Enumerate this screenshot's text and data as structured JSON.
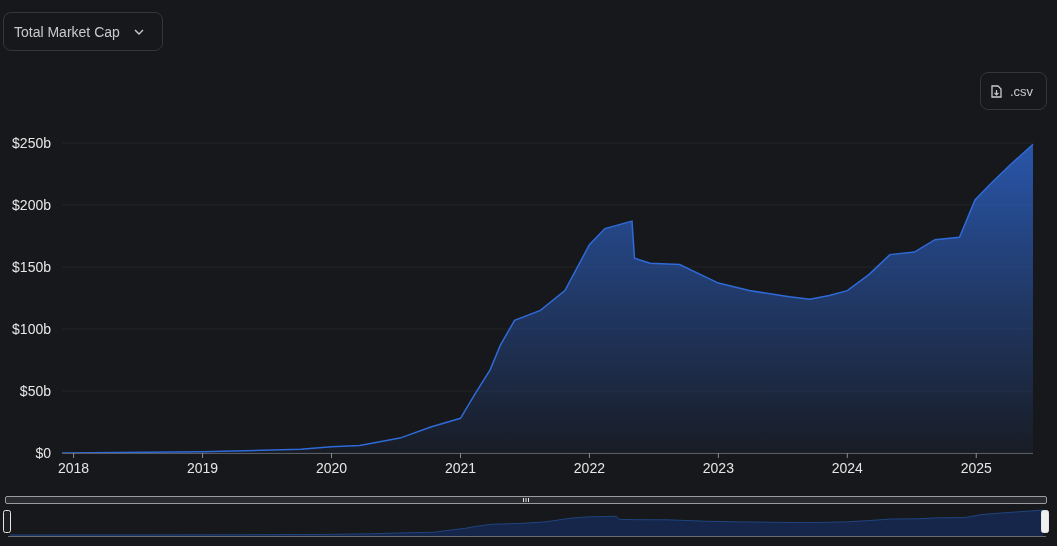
{
  "metric_dropdown": {
    "label": "Total Market Cap"
  },
  "csv_button": {
    "label": ".csv"
  },
  "chart_data": {
    "type": "area",
    "x": [
      2017.91,
      2019.0,
      2019.76,
      2020.0,
      2020.22,
      2020.53,
      2020.77,
      2021.0,
      2021.11,
      2021.23,
      2021.31,
      2021.42,
      2021.62,
      2021.81,
      2022.0,
      2022.12,
      2022.33,
      2022.35,
      2022.47,
      2022.7,
      2023.0,
      2023.24,
      2023.55,
      2023.71,
      2023.86,
      2024.0,
      2024.17,
      2024.33,
      2024.52,
      2024.68,
      2024.87,
      2024.99,
      2025.1,
      2025.26,
      2025.44
    ],
    "series": [
      {
        "color": "#2f6ad9",
        "values": [
          0,
          1,
          3,
          5,
          6,
          12,
          21,
          28,
          47,
          67,
          87,
          107,
          115,
          131,
          168,
          181,
          187,
          157,
          153,
          152,
          137,
          131,
          126,
          124,
          127,
          131,
          144,
          160,
          162,
          172,
          174,
          204,
          216,
          232,
          249
        ]
      }
    ],
    "xlim": [
      2017.91,
      2025.44
    ],
    "ylim": [
      0,
      250
    ],
    "xticks": [
      {
        "value": 2018,
        "label": "2018"
      },
      {
        "value": 2019,
        "label": "2019"
      },
      {
        "value": 2020,
        "label": "2020"
      },
      {
        "value": 2021,
        "label": "2021"
      },
      {
        "value": 2022,
        "label": "2022"
      },
      {
        "value": 2023,
        "label": "2023"
      },
      {
        "value": 2024,
        "label": "2024"
      },
      {
        "value": 2025,
        "label": "2025"
      }
    ],
    "yticks": [
      {
        "value": 0,
        "label": "$0"
      },
      {
        "value": 50,
        "label": "$50b"
      },
      {
        "value": 100,
        "label": "$100b"
      },
      {
        "value": 150,
        "label": "$150b"
      },
      {
        "value": 200,
        "label": "$200b"
      },
      {
        "value": 250,
        "label": "$250b"
      }
    ]
  }
}
